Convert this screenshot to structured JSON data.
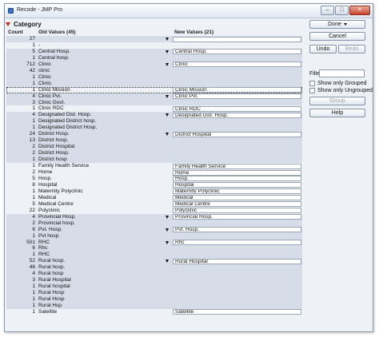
{
  "window": {
    "title": "Recode - JMP Pro"
  },
  "header": {
    "title": "Category",
    "col_count": "Count",
    "col_old": "Old Values (45)",
    "col_new": "New Values (21)"
  },
  "panel": {
    "done": "Done",
    "cancel": "Cancel",
    "undo": "Undo",
    "redo": "Redo",
    "filter_label": "Filter",
    "filter_value": "",
    "show_grouped": "Show only Grouped",
    "show_ungrouped": "Show only Ungrouped",
    "group": "Group",
    "help": "Help"
  },
  "groups": [
    {
      "shaded": true,
      "new": "",
      "items": [
        {
          "count": "27",
          "old": ""
        }
      ]
    },
    {
      "shaded": false,
      "new": null,
      "items": [
        {
          "count": "1",
          "old": "-"
        }
      ]
    },
    {
      "shaded": true,
      "new": "Central Hosp.",
      "items": [
        {
          "count": "5",
          "old": "Central Hosp."
        },
        {
          "count": "1",
          "old": "Central hosp."
        }
      ]
    },
    {
      "shaded": true,
      "new": "Clinic",
      "items": [
        {
          "count": "712",
          "old": "Clinic"
        },
        {
          "count": "42",
          "old": "clinic"
        },
        {
          "count": "1",
          "old": "Clinic "
        },
        {
          "count": "1",
          "old": "Clinic."
        }
      ]
    },
    {
      "shaded": false,
      "new": "Clinic Mission",
      "selected": true,
      "items": [
        {
          "count": "1",
          "old": "Clinic Mission"
        }
      ]
    },
    {
      "shaded": true,
      "new": "Clinic Pvt.",
      "items": [
        {
          "count": "4",
          "old": "Clinic Pvt."
        },
        {
          "count": "3",
          "old": "Clinic Govt."
        }
      ]
    },
    {
      "shaded": false,
      "new": "Clinic RDC",
      "items": [
        {
          "count": "1",
          "old": "Clinic RDC"
        }
      ]
    },
    {
      "shaded": true,
      "new": "Designated Dist. Hosp.",
      "items": [
        {
          "count": "4",
          "old": "Designated Dist. Hosp."
        },
        {
          "count": "1",
          "old": "Designated District hosp."
        },
        {
          "count": "1",
          "old": "Designated District Hosp."
        }
      ]
    },
    {
      "shaded": true,
      "new": "District Hospital",
      "items": [
        {
          "count": "24",
          "old": "District Hosp."
        },
        {
          "count": "13",
          "old": "District hosp."
        },
        {
          "count": "2",
          "old": "District Hospital"
        },
        {
          "count": "2",
          "old": "District Hosp."
        },
        {
          "count": "1",
          "old": "District hosp"
        }
      ]
    },
    {
      "shaded": false,
      "new": "Family Health Service",
      "items": [
        {
          "count": "1",
          "old": "Family Health Service"
        }
      ]
    },
    {
      "shaded": false,
      "new": "Home",
      "items": [
        {
          "count": "2",
          "old": "Home"
        }
      ]
    },
    {
      "shaded": false,
      "new": "Hosp.",
      "items": [
        {
          "count": "5",
          "old": "Hosp."
        }
      ]
    },
    {
      "shaded": false,
      "new": "Hospital",
      "items": [
        {
          "count": "8",
          "old": "Hospital"
        }
      ]
    },
    {
      "shaded": false,
      "new": "Maternity Polyclinic",
      "items": [
        {
          "count": "1",
          "old": "Maternity Polyclinic"
        }
      ]
    },
    {
      "shaded": false,
      "new": "Medical",
      "items": [
        {
          "count": "1",
          "old": "Medical"
        }
      ]
    },
    {
      "shaded": false,
      "new": "Medical Centre",
      "items": [
        {
          "count": "5",
          "old": "Medical Centre"
        }
      ]
    },
    {
      "shaded": false,
      "new": "Polyclinic",
      "items": [
        {
          "count": "22",
          "old": "Polyclinic"
        }
      ]
    },
    {
      "shaded": true,
      "new": "Provincial Hosp.",
      "items": [
        {
          "count": "4",
          "old": "Provincial Hosp."
        },
        {
          "count": "2",
          "old": "Provincial hosp."
        }
      ]
    },
    {
      "shaded": true,
      "new": "Pvt. Hosp.",
      "items": [
        {
          "count": "6",
          "old": "Pvt. Hosp."
        },
        {
          "count": "1",
          "old": "Pvt hosp."
        }
      ]
    },
    {
      "shaded": true,
      "new": "Rhc",
      "items": [
        {
          "count": "501",
          "old": "RHC"
        },
        {
          "count": "6",
          "old": "Rhc"
        },
        {
          "count": "1",
          "old": "RHC "
        }
      ]
    },
    {
      "shaded": true,
      "new": "Rural Hospital",
      "items": [
        {
          "count": "52",
          "old": "Rural hosp."
        },
        {
          "count": "46",
          "old": "Rural hosp."
        },
        {
          "count": "4",
          "old": "Rural hosp"
        },
        {
          "count": "3",
          "old": "Rural Hospital"
        },
        {
          "count": "1",
          "old": "Rural hospital"
        },
        {
          "count": "1",
          "old": "Rural Hosp"
        },
        {
          "count": "1",
          "old": "Rural Hosp"
        },
        {
          "count": "1",
          "old": "Rural Hsp."
        }
      ]
    },
    {
      "shaded": false,
      "new": "Satellite",
      "items": [
        {
          "count": "1",
          "old": "Satellite"
        }
      ]
    }
  ]
}
